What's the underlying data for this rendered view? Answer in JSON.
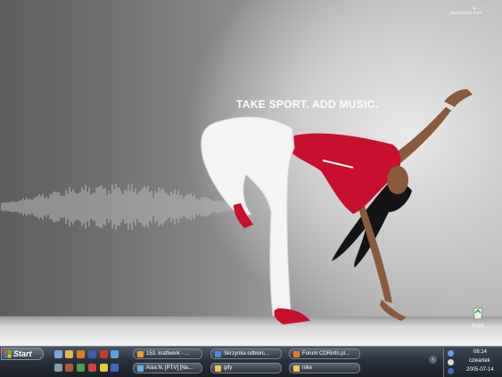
{
  "wallpaper": {
    "tagline": "TAKE SPORT. ADD MUSIC.",
    "brand_url": "nikewomen.com"
  },
  "desktop_icons": [
    {
      "name": "recycle-bin",
      "label": "Kosz"
    }
  ],
  "taskbar": {
    "start_label": "Start",
    "windows_row1": [
      {
        "label": "153. kraftwerk - ...",
        "icon": "winamp-icon"
      },
      {
        "label": "Skrzynka odbiorc...",
        "icon": "mail-icon"
      },
      {
        "label": "Forum CDRinfo.pl...",
        "icon": "firefox-icon"
      }
    ],
    "windows_row2": [
      {
        "label": "Asia N. [PTV] [Na...",
        "icon": "chat-icon"
      },
      {
        "label": "gify",
        "icon": "folder-icon"
      },
      {
        "label": "nike",
        "icon": "folder-icon"
      }
    ],
    "clock": {
      "time": "08:14",
      "day": "czwartek",
      "date": "2005-07-14"
    }
  },
  "colors": {
    "accent_red": "#c8102e",
    "taskbar": "#2a313b"
  }
}
